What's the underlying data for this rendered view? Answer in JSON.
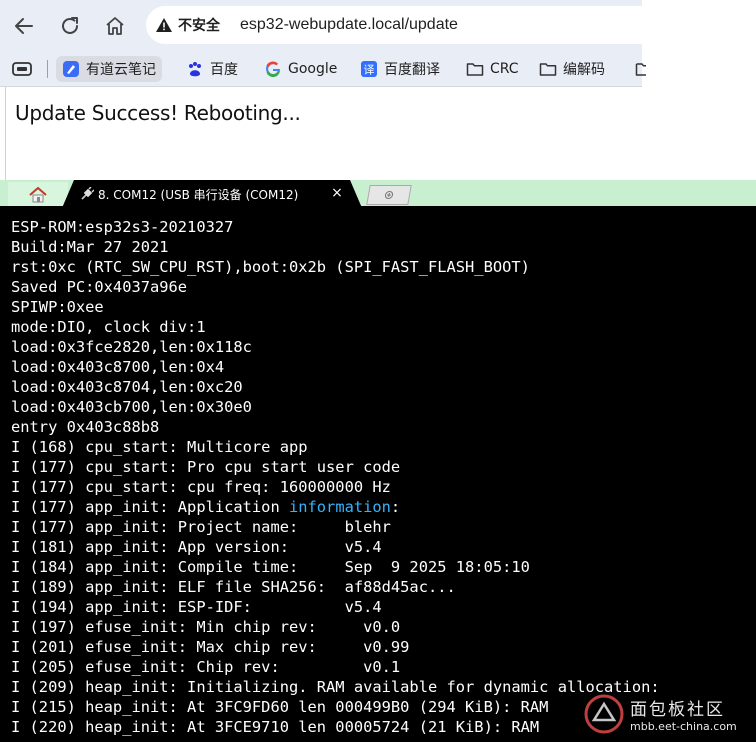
{
  "browser": {
    "address": {
      "security_label": "不安全",
      "url": "esp32-webupdate.local/update"
    },
    "bookmarks": [
      {
        "label": "有道云笔记",
        "icon": "youdao-note-icon"
      },
      {
        "label": "百度",
        "icon": "baidu-paw-icon"
      },
      {
        "label": "Google",
        "icon": "google-g-icon"
      },
      {
        "label": "百度翻译",
        "icon": "baidu-translate-icon"
      },
      {
        "label": "CRC",
        "icon": "folder-icon"
      },
      {
        "label": "编解码",
        "icon": "folder-icon"
      }
    ],
    "page": {
      "message": "Update Success! Rebooting..."
    }
  },
  "terminal": {
    "tab_title": "8. COM12  (USB 串行设备 (COM12)",
    "lines": [
      "ESP-ROM:esp32s3-20210327",
      "Build:Mar 27 2021",
      "rst:0xc (RTC_SW_CPU_RST),boot:0x2b (SPI_FAST_FLASH_BOOT)",
      "Saved PC:0x4037a96e",
      "SPIWP:0xee",
      "mode:DIO, clock div:1",
      "load:0x3fce2820,len:0x118c",
      "load:0x403c8700,len:0x4",
      "load:0x403c8704,len:0xc20",
      "load:0x403cb700,len:0x30e0",
      "entry 0x403c88b8",
      "I (168) cpu_start: Multicore app",
      "I (177) cpu_start: Pro cpu start user code",
      "I (177) cpu_start: cpu freq: 160000000 Hz",
      "I (177) app_init: Application ",
      "I (177) app_init: Project name:     blehr",
      "I (181) app_init: App version:      v5.4",
      "I (184) app_init: Compile time:     Sep  9 2025 18:05:10",
      "I (189) app_init: ELF file SHA256:  af88d45ac...",
      "I (194) app_init: ESP-IDF:          v5.4",
      "I (197) efuse_init: Min chip rev:     v0.0",
      "I (201) efuse_init: Max chip rev:     v0.99",
      "I (205) efuse_init: Chip rev:         v0.1",
      "I (209) heap_init: Initializing. RAM available for dynamic allocation:",
      "I (215) heap_init: At 3FC9FD60 len 000499B0 (294 KiB): RAM",
      "I (220) heap_init: At 3FCE9710 len 00005724 (21 KiB): RAM"
    ],
    "highlight_word": "information",
    "highlight_suffix": ":",
    "highlight_color": "#34b4ff"
  },
  "watermark": {
    "cn": "面包板社区",
    "url": "mbb.eet-china.com"
  }
}
